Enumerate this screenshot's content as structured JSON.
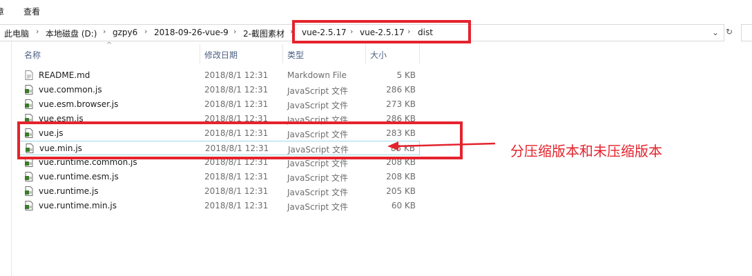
{
  "menu": {
    "item_left": "章",
    "view": "查看"
  },
  "breadcrumb": [
    "此电脑",
    "本地磁盘 (D:)",
    "gzpy6",
    "2018-09-26-vue-9",
    "2-截图素材",
    "vue-2.5.17",
    "vue-2.5.17",
    "dist"
  ],
  "columns": {
    "name": "名称",
    "date": "修改日期",
    "type": "类型",
    "size": "大小"
  },
  "files": [
    {
      "name": "README.md",
      "date": "2018/8/1 12:31",
      "type": "Markdown File",
      "size": "5 KB",
      "icon": "markdown-file-icon"
    },
    {
      "name": "vue.common.js",
      "date": "2018/8/1 12:31",
      "type": "JavaScript 文件",
      "size": "286 KB",
      "icon": "js-file-icon"
    },
    {
      "name": "vue.esm.browser.js",
      "date": "2018/8/1 12:31",
      "type": "JavaScript 文件",
      "size": "273 KB",
      "icon": "js-file-icon"
    },
    {
      "name": "vue.esm.js",
      "date": "2018/8/1 12:31",
      "type": "JavaScript 文件",
      "size": "286 KB",
      "icon": "js-file-icon"
    },
    {
      "name": "vue.js",
      "date": "2018/8/1 12:31",
      "type": "JavaScript 文件",
      "size": "283 KB",
      "icon": "js-file-icon"
    },
    {
      "name": "vue.min.js",
      "date": "2018/8/1 12:31",
      "type": "JavaScript 文件",
      "size": "85 KB",
      "icon": "js-file-icon"
    },
    {
      "name": "vue.runtime.common.js",
      "date": "2018/8/1 12:31",
      "type": "JavaScript 文件",
      "size": "208 KB",
      "icon": "js-file-icon"
    },
    {
      "name": "vue.runtime.esm.js",
      "date": "2018/8/1 12:31",
      "type": "JavaScript 文件",
      "size": "208 KB",
      "icon": "js-file-icon"
    },
    {
      "name": "vue.runtime.js",
      "date": "2018/8/1 12:31",
      "type": "JavaScript 文件",
      "size": "205 KB",
      "icon": "js-file-icon"
    },
    {
      "name": "vue.runtime.min.js",
      "date": "2018/8/1 12:31",
      "type": "JavaScript 文件",
      "size": "60 KB",
      "icon": "js-file-icon"
    }
  ],
  "annotation": {
    "text": "分压缩版本和未压缩版本",
    "color": "#e4232d"
  },
  "colors": {
    "accent_red": "#e4232d",
    "header_text": "#4d6082",
    "hover_border": "#99d9ea"
  }
}
